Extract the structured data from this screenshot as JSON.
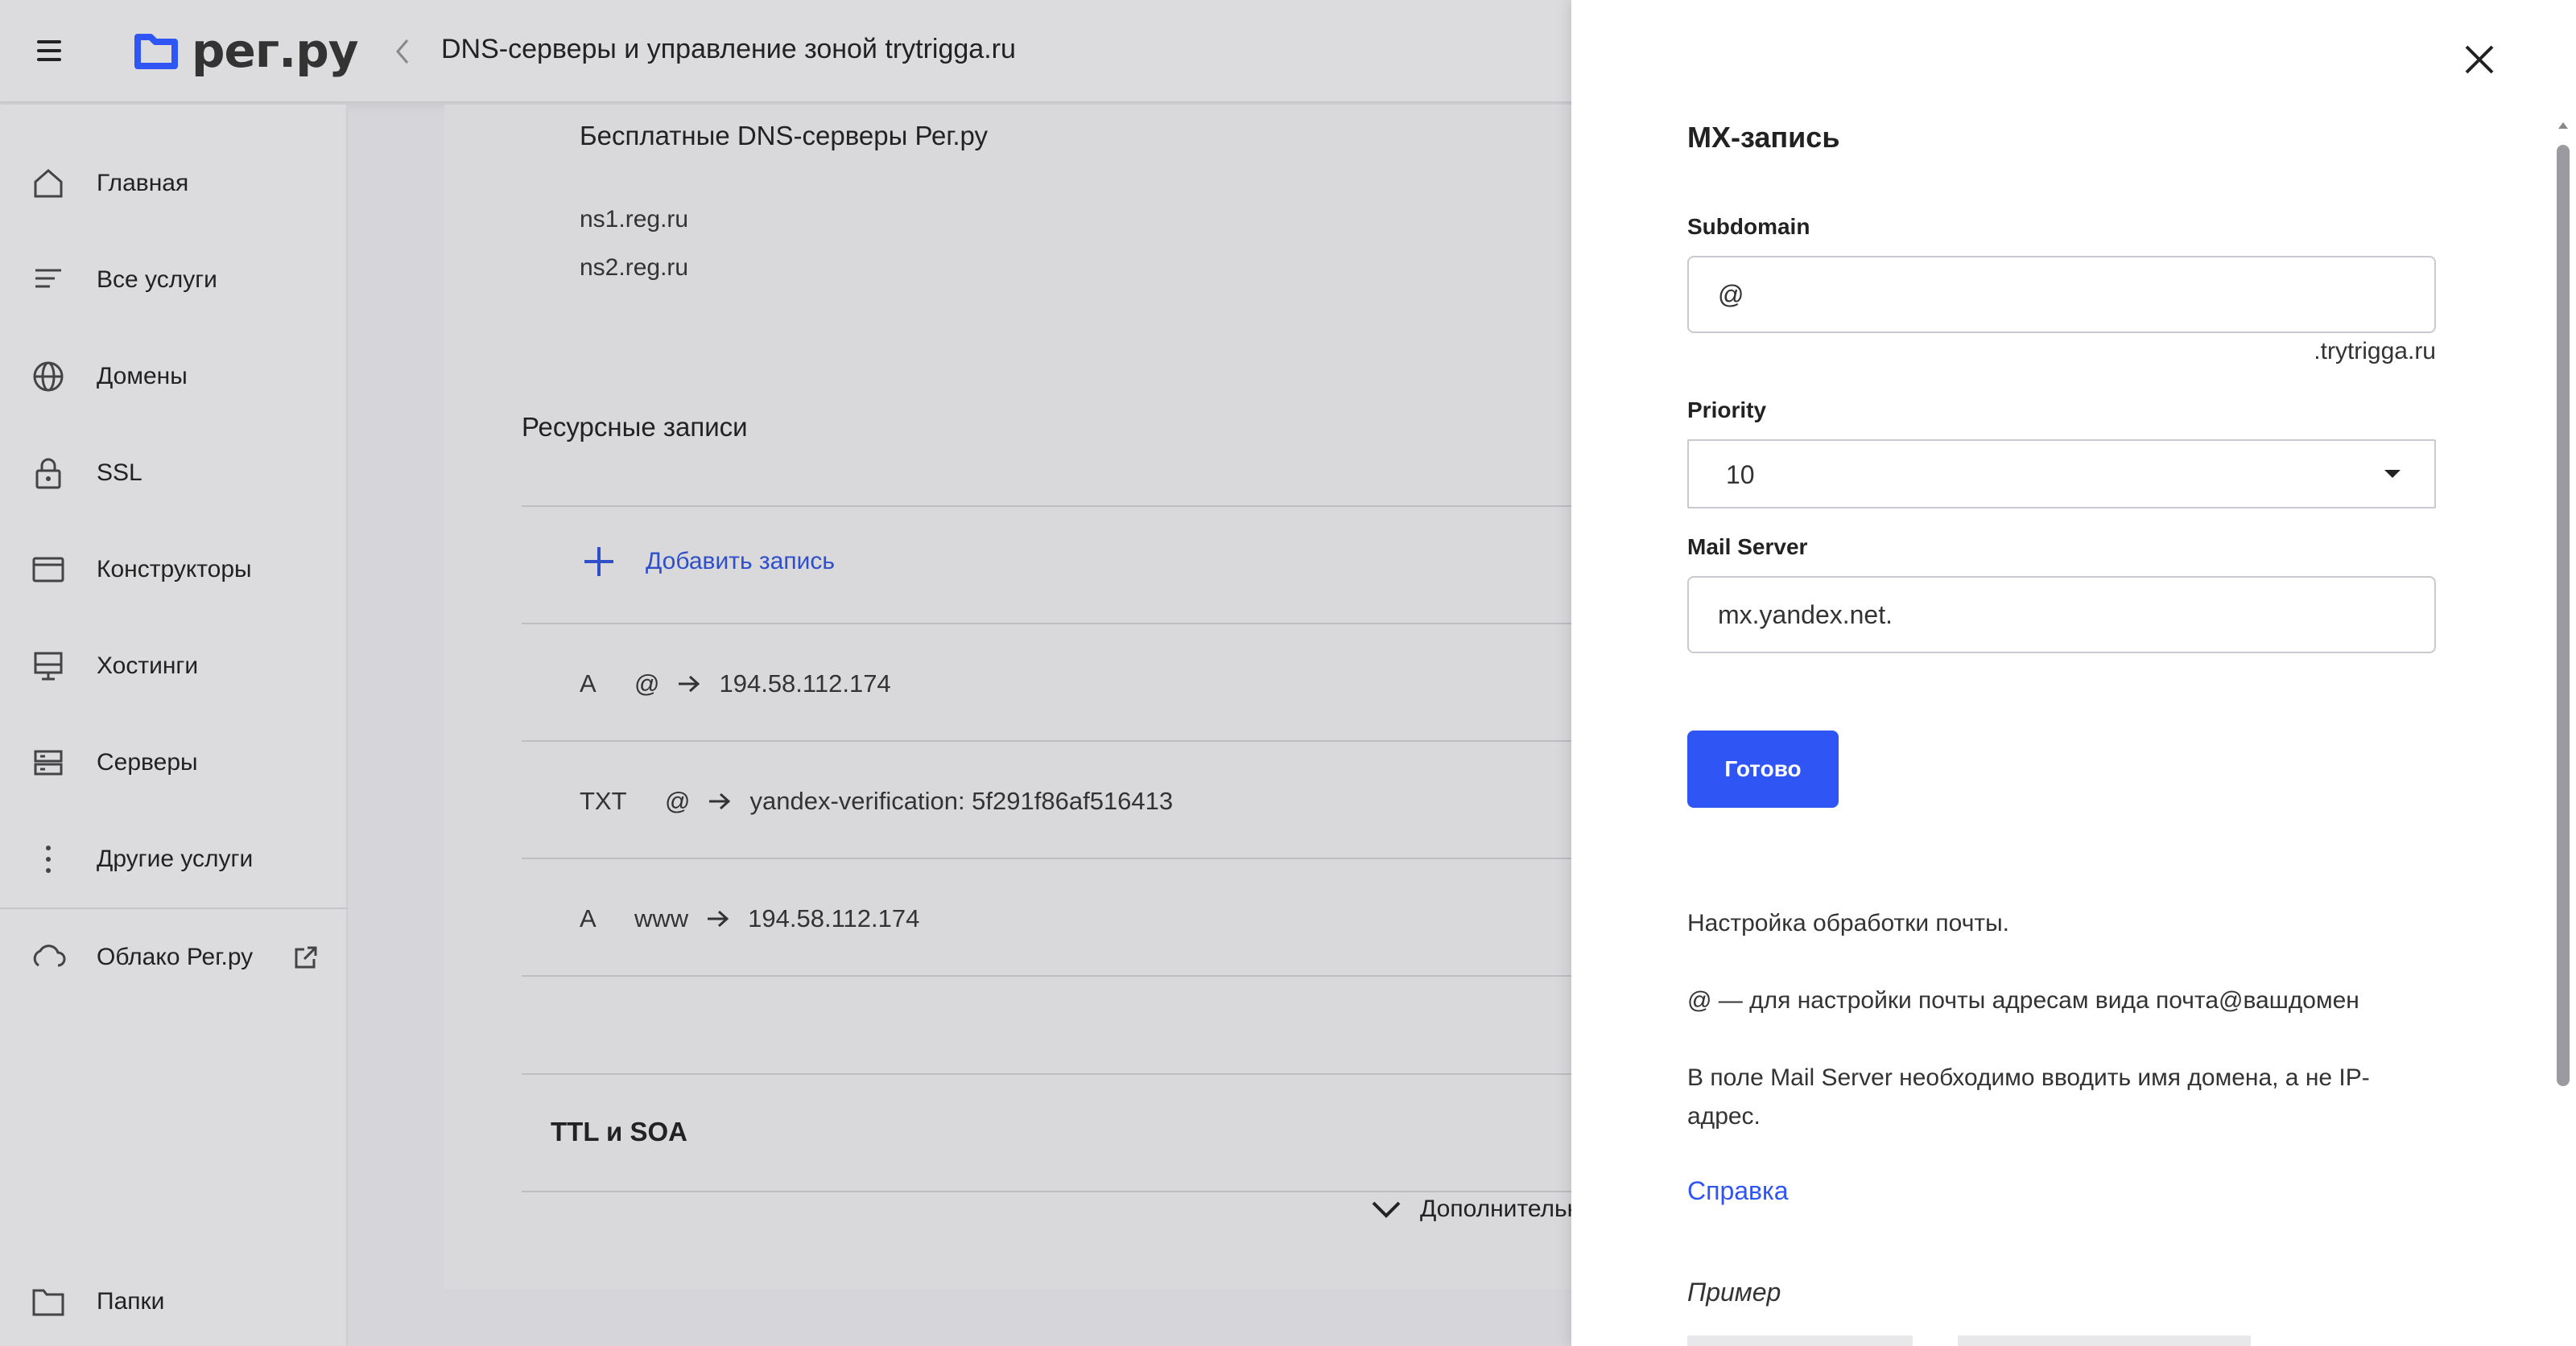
{
  "header": {
    "logo_text": "рег.ру",
    "page_title": "DNS-серверы и управление зоной trytrigga.ru"
  },
  "sidebar": {
    "items": [
      {
        "label": "Главная",
        "icon": "home-icon"
      },
      {
        "label": "Все услуги",
        "icon": "list-icon"
      },
      {
        "label": "Домены",
        "icon": "globe-icon"
      },
      {
        "label": "SSL",
        "icon": "lock-icon"
      },
      {
        "label": "Конструкторы",
        "icon": "window-icon"
      },
      {
        "label": "Хостинги",
        "icon": "monitor-icon"
      },
      {
        "label": "Серверы",
        "icon": "server-icon"
      },
      {
        "label": "Другие услуги",
        "icon": "more-vertical-icon"
      }
    ],
    "cloud_label": "Облако Рег.ру",
    "folders_label": "Папки"
  },
  "dns": {
    "servers_title": "Бесплатные DNS-серверы Рег.ру",
    "servers": [
      "ns1.reg.ru",
      "ns2.reg.ru"
    ],
    "records_title": "Ресурсные записи",
    "add_label": "Добавить запись",
    "records": [
      {
        "type": "A",
        "host": "@",
        "value": "194.58.112.174"
      },
      {
        "type": "TXT",
        "host": "@",
        "value": "yandex-verification: 5f291f86af516413"
      },
      {
        "type": "A",
        "host": "www",
        "value": "194.58.112.174"
      }
    ],
    "ttl_title": "TTL и SOA",
    "more_label": "Дополнительн"
  },
  "drawer": {
    "title": "MX-запись",
    "subdomain_label": "Subdomain",
    "subdomain_value": "@",
    "subdomain_suffix": ".trytrigga.ru",
    "priority_label": "Priority",
    "priority_value": "10",
    "mail_server_label": "Mail Server",
    "mail_server_value": "mx.yandex.net.",
    "submit_label": "Готово",
    "help_1": "Настройка обработки почты.",
    "help_2": "@ — для настройки почты адресам вида почта@вашдомен",
    "help_3": "В поле Mail Server необходимо вводить имя домена, а не IP-адрес.",
    "help_link": "Справка",
    "example_label": "Пример"
  },
  "colors": {
    "accent": "#2f55f5",
    "link": "#2f4fc9",
    "overlay_bg": "#d6d6da",
    "drawer_bg": "#ffffff"
  }
}
